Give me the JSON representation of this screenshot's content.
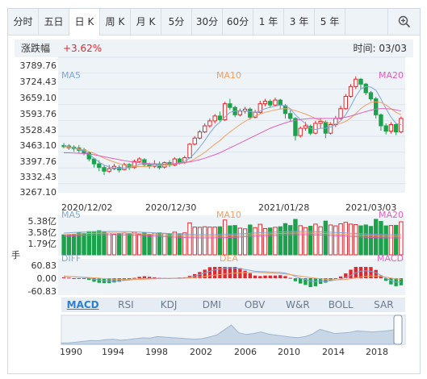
{
  "tabs": [
    {
      "label": "分时",
      "active": false
    },
    {
      "label": "五日",
      "active": false
    },
    {
      "label": "日 K",
      "active": true
    },
    {
      "label": "周 K",
      "active": false
    },
    {
      "label": "月 K",
      "active": false
    },
    {
      "label": "5分",
      "active": false
    },
    {
      "label": "30分",
      "active": false
    },
    {
      "label": "60分",
      "active": false
    },
    {
      "label": "1 年",
      "active": false
    },
    {
      "label": "3 年",
      "active": false
    },
    {
      "label": "5 年",
      "active": false
    }
  ],
  "zoom_icon": "zoom-in-icon",
  "info": {
    "change_label": "涨跌幅",
    "change_value": "+3.62%",
    "time_label": "时间: 03/03"
  },
  "colors": {
    "up": "#e0282e",
    "down": "#1aa34a",
    "ma5": "#7fa7d8",
    "ma10": "#f0a060",
    "ma20": "#e060c0",
    "panel_bg": "#eef3f8"
  },
  "price_panel": {
    "y_ticks": [
      "3789.76",
      "3724.43",
      "3659.10",
      "3593.76",
      "3528.43",
      "3463.10",
      "3397.76",
      "3332.43",
      "3267.10"
    ],
    "x_ticks": [
      "2020/12/02",
      "2020/12/30",
      "2021/01/28",
      "2021/03/03"
    ],
    "ma5_label": "MA5",
    "ma10_label": "MA10",
    "ma20_label": "MA20"
  },
  "volume_panel": {
    "y_ticks": [
      "5.38亿",
      "3.58亿",
      "1.79亿",
      "手"
    ],
    "ma5_label": "MA5",
    "ma10_label": "MA10",
    "ma20_label": "MA20"
  },
  "macd_panel": {
    "y_ticks": [
      "60.83",
      "0.00",
      "-60.83"
    ],
    "diff_label": "DIFF",
    "dea_label": "DEA",
    "macd_label": "MACD"
  },
  "indicator_tabs": [
    {
      "label": "MACD",
      "active": true
    },
    {
      "label": "RSI",
      "active": false
    },
    {
      "label": "KDJ",
      "active": false
    },
    {
      "label": "DMI",
      "active": false
    },
    {
      "label": "OBV",
      "active": false
    },
    {
      "label": "W&R",
      "active": false
    },
    {
      "label": "BOLL",
      "active": false
    },
    {
      "label": "SAR",
      "active": false
    }
  ],
  "overview": {
    "x_ticks": [
      "1990",
      "1994",
      "1998",
      "2002",
      "2006",
      "2010",
      "2014",
      "2018"
    ]
  },
  "chart_data": {
    "type": "candlestick",
    "period": "daily",
    "y_range": [
      3267.1,
      3789.76
    ],
    "x_range": [
      "2020/12/02",
      "2021/03/03"
    ],
    "candles": [
      {
        "o": 3450,
        "c": 3445,
        "h": 3460,
        "l": 3438
      },
      {
        "o": 3448,
        "c": 3440,
        "h": 3455,
        "l": 3432
      },
      {
        "o": 3443,
        "c": 3437,
        "h": 3450,
        "l": 3425
      },
      {
        "o": 3440,
        "c": 3430,
        "h": 3452,
        "l": 3420
      },
      {
        "o": 3432,
        "c": 3420,
        "h": 3440,
        "l": 3410
      },
      {
        "o": 3420,
        "c": 3395,
        "h": 3425,
        "l": 3385
      },
      {
        "o": 3395,
        "c": 3375,
        "h": 3400,
        "l": 3360
      },
      {
        "o": 3375,
        "c": 3360,
        "h": 3390,
        "l": 3345
      },
      {
        "o": 3360,
        "c": 3345,
        "h": 3368,
        "l": 3330
      },
      {
        "o": 3345,
        "c": 3355,
        "h": 3370,
        "l": 3338
      },
      {
        "o": 3355,
        "c": 3365,
        "h": 3375,
        "l": 3350
      },
      {
        "o": 3360,
        "c": 3350,
        "h": 3370,
        "l": 3340
      },
      {
        "o": 3352,
        "c": 3372,
        "h": 3380,
        "l": 3348
      },
      {
        "o": 3372,
        "c": 3360,
        "h": 3378,
        "l": 3350
      },
      {
        "o": 3360,
        "c": 3385,
        "h": 3392,
        "l": 3355
      },
      {
        "o": 3385,
        "c": 3395,
        "h": 3402,
        "l": 3378
      },
      {
        "o": 3392,
        "c": 3372,
        "h": 3398,
        "l": 3365
      },
      {
        "o": 3372,
        "c": 3365,
        "h": 3380,
        "l": 3355
      },
      {
        "o": 3365,
        "c": 3375,
        "h": 3390,
        "l": 3358
      },
      {
        "o": 3375,
        "c": 3360,
        "h": 3385,
        "l": 3352
      },
      {
        "o": 3362,
        "c": 3380,
        "h": 3385,
        "l": 3355
      },
      {
        "o": 3380,
        "c": 3370,
        "h": 3390,
        "l": 3362
      },
      {
        "o": 3370,
        "c": 3395,
        "h": 3402,
        "l": 3365
      },
      {
        "o": 3395,
        "c": 3380,
        "h": 3400,
        "l": 3372
      },
      {
        "o": 3380,
        "c": 3400,
        "h": 3408,
        "l": 3375
      },
      {
        "o": 3400,
        "c": 3455,
        "h": 3460,
        "l": 3398
      },
      {
        "o": 3455,
        "c": 3480,
        "h": 3488,
        "l": 3450
      },
      {
        "o": 3480,
        "c": 3505,
        "h": 3512,
        "l": 3475
      },
      {
        "o": 3505,
        "c": 3530,
        "h": 3540,
        "l": 3500
      },
      {
        "o": 3530,
        "c": 3550,
        "h": 3560,
        "l": 3522
      },
      {
        "o": 3550,
        "c": 3570,
        "h": 3578,
        "l": 3540
      },
      {
        "o": 3570,
        "c": 3555,
        "h": 3588,
        "l": 3548
      },
      {
        "o": 3555,
        "c": 3620,
        "h": 3628,
        "l": 3550
      },
      {
        "o": 3620,
        "c": 3605,
        "h": 3640,
        "l": 3595
      },
      {
        "o": 3605,
        "c": 3575,
        "h": 3612,
        "l": 3565
      },
      {
        "o": 3575,
        "c": 3590,
        "h": 3600,
        "l": 3568
      },
      {
        "o": 3590,
        "c": 3598,
        "h": 3608,
        "l": 3580
      },
      {
        "o": 3598,
        "c": 3565,
        "h": 3605,
        "l": 3555
      },
      {
        "o": 3565,
        "c": 3585,
        "h": 3595,
        "l": 3560
      },
      {
        "o": 3585,
        "c": 3620,
        "h": 3632,
        "l": 3578
      },
      {
        "o": 3620,
        "c": 3630,
        "h": 3640,
        "l": 3610
      },
      {
        "o": 3630,
        "c": 3615,
        "h": 3638,
        "l": 3605
      },
      {
        "o": 3615,
        "c": 3635,
        "h": 3645,
        "l": 3608
      },
      {
        "o": 3635,
        "c": 3615,
        "h": 3640,
        "l": 3600
      },
      {
        "o": 3612,
        "c": 3580,
        "h": 3618,
        "l": 3560
      },
      {
        "o": 3580,
        "c": 3560,
        "h": 3595,
        "l": 3548
      },
      {
        "o": 3560,
        "c": 3490,
        "h": 3565,
        "l": 3470
      },
      {
        "o": 3490,
        "c": 3520,
        "h": 3528,
        "l": 3482
      },
      {
        "o": 3520,
        "c": 3530,
        "h": 3545,
        "l": 3510
      },
      {
        "o": 3528,
        "c": 3500,
        "h": 3535,
        "l": 3492
      },
      {
        "o": 3500,
        "c": 3540,
        "h": 3550,
        "l": 3495
      },
      {
        "o": 3540,
        "c": 3548,
        "h": 3560,
        "l": 3520
      },
      {
        "o": 3545,
        "c": 3500,
        "h": 3552,
        "l": 3480
      },
      {
        "o": 3500,
        "c": 3535,
        "h": 3545,
        "l": 3495
      },
      {
        "o": 3535,
        "c": 3560,
        "h": 3570,
        "l": 3525
      },
      {
        "o": 3560,
        "c": 3600,
        "h": 3612,
        "l": 3555
      },
      {
        "o": 3600,
        "c": 3650,
        "h": 3660,
        "l": 3595
      },
      {
        "o": 3650,
        "c": 3690,
        "h": 3700,
        "l": 3645
      },
      {
        "o": 3690,
        "c": 3720,
        "h": 3732,
        "l": 3680
      },
      {
        "o": 3720,
        "c": 3700,
        "h": 3725,
        "l": 3680
      },
      {
        "o": 3700,
        "c": 3665,
        "h": 3705,
        "l": 3655
      },
      {
        "o": 3665,
        "c": 3640,
        "h": 3672,
        "l": 3630
      },
      {
        "o": 3640,
        "c": 3575,
        "h": 3648,
        "l": 3560
      },
      {
        "o": 3575,
        "c": 3530,
        "h": 3580,
        "l": 3510
      },
      {
        "o": 3530,
        "c": 3508,
        "h": 3540,
        "l": 3495
      },
      {
        "o": 3508,
        "c": 3535,
        "h": 3545,
        "l": 3498
      },
      {
        "o": 3535,
        "c": 3505,
        "h": 3540,
        "l": 3492
      },
      {
        "o": 3505,
        "c": 3560,
        "h": 3568,
        "l": 3500
      }
    ],
    "ma5": [
      3450,
      3445,
      3440,
      3432,
      3428,
      3415,
      3398,
      3382,
      3370,
      3362,
      3358,
      3356,
      3358,
      3360,
      3366,
      3372,
      3375,
      3373,
      3372,
      3370,
      3371,
      3372,
      3376,
      3380,
      3385,
      3398,
      3418,
      3443,
      3470,
      3500,
      3527,
      3545,
      3566,
      3585,
      3590,
      3592,
      3590,
      3588,
      3585,
      3590,
      3600,
      3605,
      3610,
      3615,
      3612,
      3600,
      3575,
      3555,
      3540,
      3520,
      3515,
      3520,
      3520,
      3525,
      3535,
      3550,
      3575,
      3610,
      3650,
      3680,
      3690,
      3688,
      3675,
      3640,
      3600,
      3565,
      3540,
      3535
    ],
    "ma10": [
      3445,
      3442,
      3440,
      3436,
      3432,
      3425,
      3418,
      3408,
      3398,
      3390,
      3382,
      3376,
      3370,
      3366,
      3364,
      3364,
      3364,
      3365,
      3367,
      3368,
      3370,
      3372,
      3374,
      3376,
      3380,
      3385,
      3395,
      3408,
      3422,
      3438,
      3455,
      3470,
      3488,
      3505,
      3520,
      3535,
      3548,
      3560,
      3570,
      3578,
      3585,
      3590,
      3595,
      3598,
      3600,
      3598,
      3592,
      3585,
      3578,
      3570,
      3560,
      3552,
      3545,
      3540,
      3538,
      3540,
      3548,
      3562,
      3580,
      3600,
      3615,
      3625,
      3628,
      3625,
      3615,
      3600,
      3585,
      3575
    ],
    "ma20": [
      3420,
      3420,
      3419,
      3418,
      3417,
      3415,
      3412,
      3408,
      3404,
      3400,
      3396,
      3392,
      3388,
      3385,
      3382,
      3380,
      3378,
      3376,
      3375,
      3374,
      3374,
      3375,
      3376,
      3378,
      3380,
      3383,
      3387,
      3392,
      3398,
      3405,
      3412,
      3420,
      3430,
      3440,
      3450,
      3460,
      3470,
      3480,
      3490,
      3500,
      3510,
      3520,
      3528,
      3535,
      3542,
      3548,
      3552,
      3556,
      3558,
      3560,
      3560,
      3560,
      3560,
      3560,
      3560,
      3562,
      3565,
      3570,
      3576,
      3582,
      3588,
      3594,
      3598,
      3600,
      3600,
      3598,
      3595,
      3590
    ]
  }
}
